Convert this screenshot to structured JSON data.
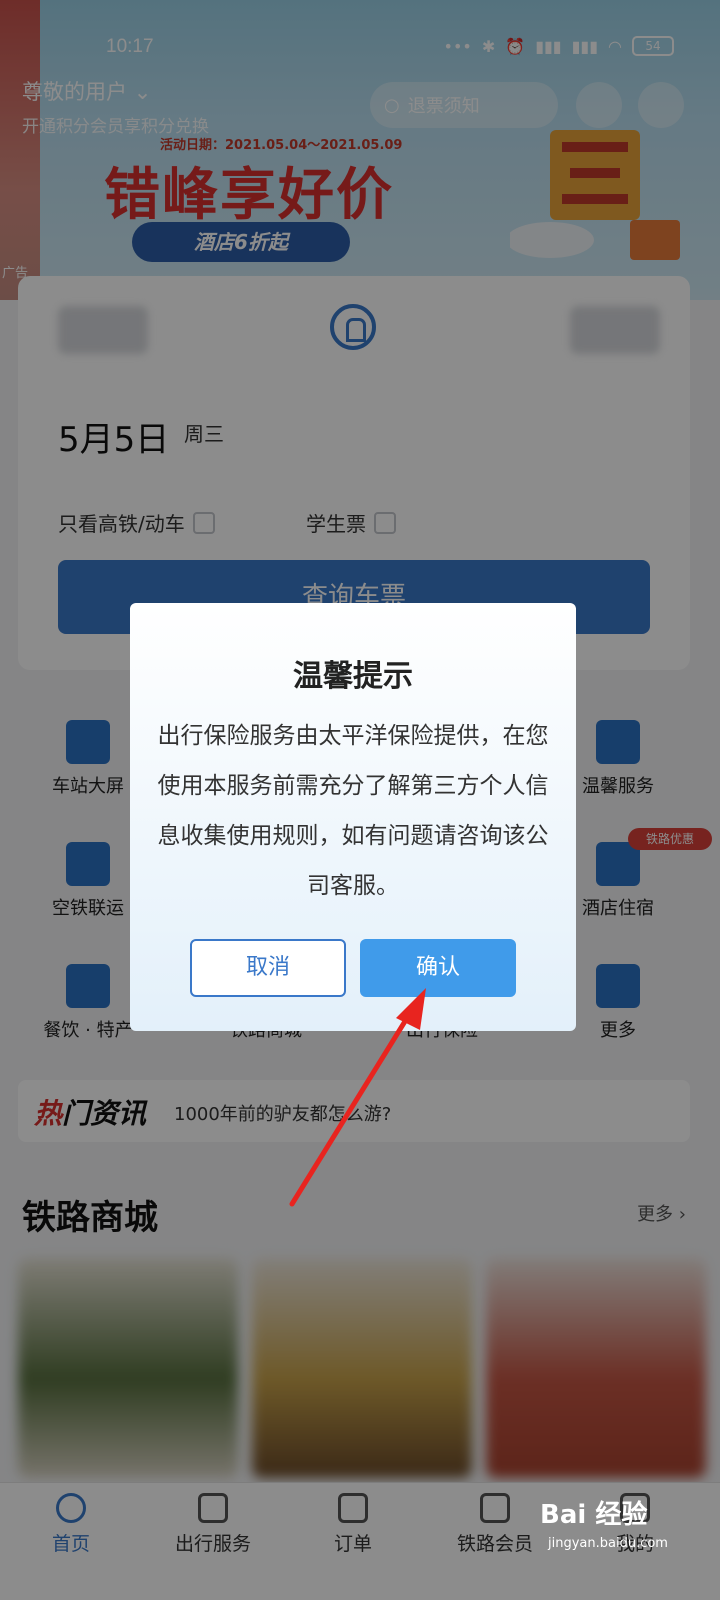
{
  "status_bar": {
    "time": "10:17",
    "battery": "54",
    "icons": [
      "dots-icon",
      "bluetooth-icon",
      "alarm-icon",
      "signal-hd-icon",
      "signal-hd-icon",
      "wifi-icon"
    ]
  },
  "header": {
    "greeting": "尊敬的用户",
    "subtitle": "开通积分会员享积分兑换",
    "search_placeholder": "退票须知"
  },
  "banner": {
    "date_range": "活动日期：2021.05.04～2021.05.09",
    "title": "错峰享好价",
    "tag": "酒店6折起",
    "ad_label": "广告"
  },
  "booking": {
    "date": "5月5日",
    "weekday": "周三",
    "option_high_speed": "只看高铁/动车",
    "option_student": "学生票",
    "query_button": "查询车票"
  },
  "services": [
    {
      "label": "车站大屏"
    },
    {
      "label": "温馨服务"
    },
    {
      "label": "空铁联运"
    },
    {
      "label": "酒店住宿",
      "badge": "铁路优惠"
    },
    {
      "label": "餐饮 · 特产"
    },
    {
      "label": "铁路商城"
    },
    {
      "label": "出行保险"
    },
    {
      "label": "更多"
    }
  ],
  "hot_news": {
    "logo_red": "热",
    "logo_rest": "门资讯",
    "text": "1000年前的驴友都怎么游?"
  },
  "mall": {
    "title": "铁路商城",
    "more": "更多"
  },
  "tabs": [
    "首页",
    "出行服务",
    "订单",
    "铁路会员",
    "我的"
  ],
  "dialog": {
    "title": "温馨提示",
    "body": "出行保险服务由太平洋保险提供，在您使用本服务前需充分了解第三方个人信息收集使用规则，如有问题请咨询该公司客服。",
    "cancel": "取消",
    "confirm": "确认"
  },
  "watermark": {
    "main": "Bai 经验",
    "sub": "jingyan.baidu.com"
  },
  "colors": {
    "accent": "#3a78c9",
    "confirm": "#409bea",
    "arrow": "#e8241f",
    "promo": "#d8312e"
  }
}
